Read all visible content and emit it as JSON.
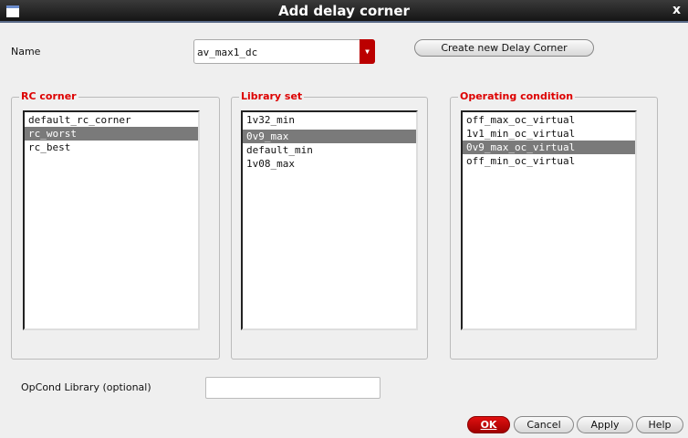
{
  "window": {
    "title": "Add delay corner",
    "close": "x"
  },
  "name": {
    "label": "Name",
    "value": "av_max1_dc"
  },
  "create_button": "Create new Delay Corner",
  "rc_corner": {
    "label": "RC corner",
    "items": [
      "default_rc_corner",
      "rc_worst",
      "rc_best"
    ],
    "selected": "rc_worst"
  },
  "library_set": {
    "label": "Library set",
    "items": [
      "1v32_min",
      "0v9_max",
      "default_min",
      "1v08_max"
    ],
    "selected": "0v9_max"
  },
  "operating_condition": {
    "label": "Operating condition",
    "items": [
      "off_max_oc_virtual",
      "1v1_min_oc_virtual",
      "0v9_max_oc_virtual",
      "off_min_oc_virtual"
    ],
    "selected": "0v9_max_oc_virtual"
  },
  "opcond": {
    "label": "OpCond Library (optional)",
    "value": ""
  },
  "buttons": {
    "ok": "OK",
    "cancel": "Cancel",
    "apply": "Apply",
    "help": "Help"
  }
}
